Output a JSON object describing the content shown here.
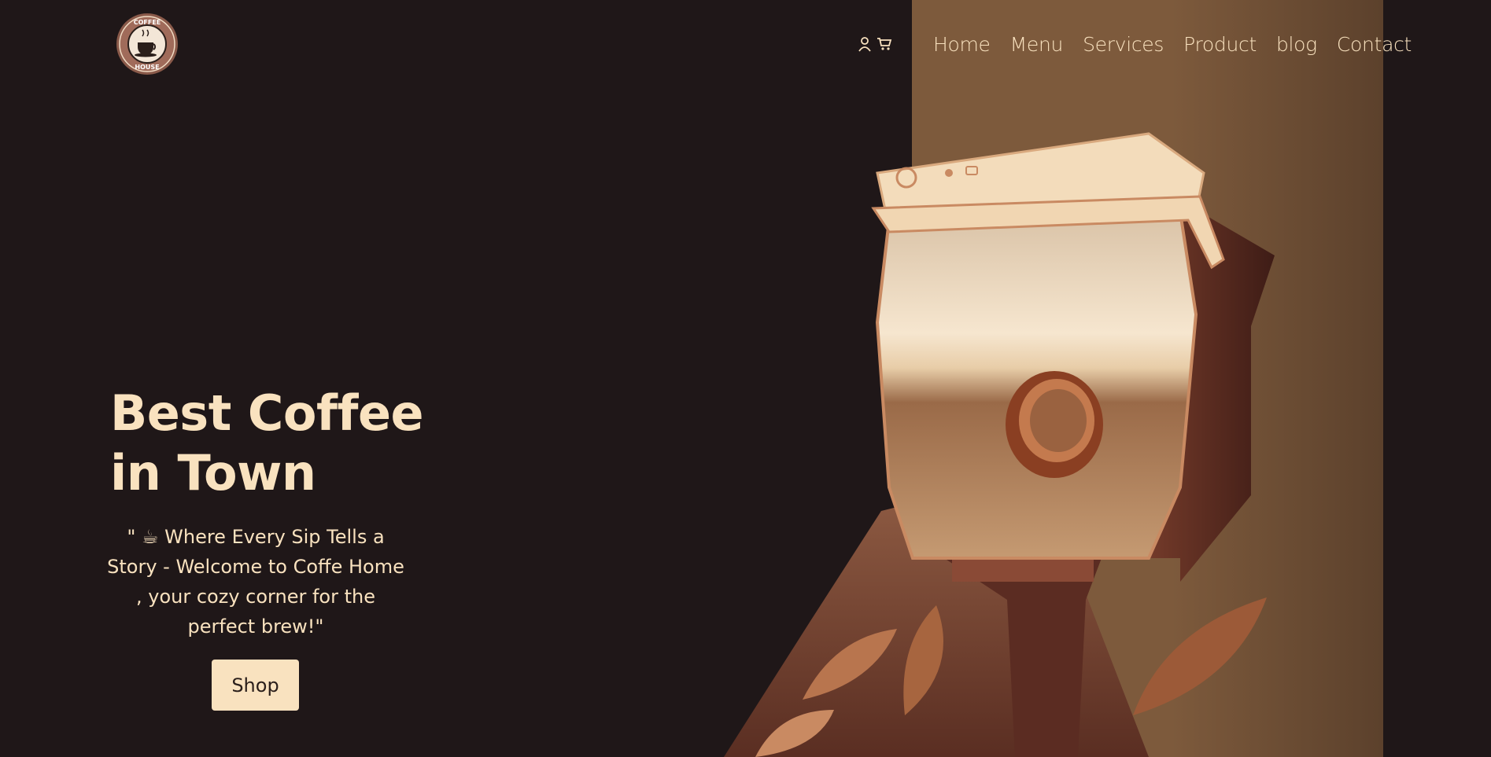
{
  "brand": {
    "logo_text_top": "COFFEE",
    "logo_text_bottom": "HOUSE"
  },
  "header": {
    "icons": [
      "user-icon",
      "cart-icon"
    ],
    "nav": [
      "Home",
      "Menu",
      "Services",
      "Product",
      "blog",
      "Contact"
    ]
  },
  "hero": {
    "title_line1": "Best Coffee",
    "title_line2": "in Town",
    "subtitle": "\" ☕ Where Every Sip Tells a Story - Welcome to Coffe Home , your cozy corner for the perfect brew!\"",
    "cta": "Shop"
  },
  "colors": {
    "background": "#1f1718",
    "panel": "#7d5a3c",
    "cream": "#f9e2bf"
  }
}
